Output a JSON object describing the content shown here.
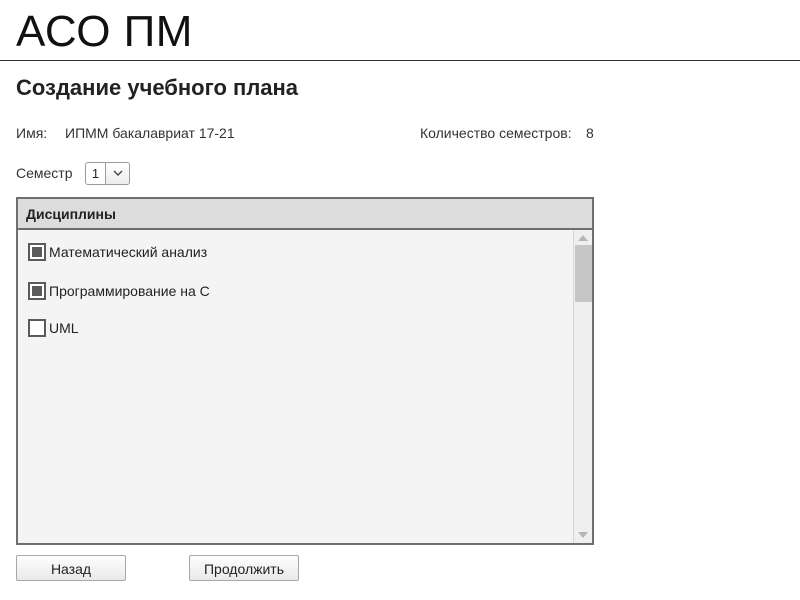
{
  "app": {
    "title": "АСО ПМ"
  },
  "page": {
    "title": "Создание учебного плана"
  },
  "info": {
    "name_label": "Имя:",
    "name_value": "ИПММ бакалавриат 17-21",
    "semester_count_label": "Количество семестров:",
    "semester_count_value": "8"
  },
  "semester": {
    "label": "Семестр",
    "selected": "1",
    "icon": "chevron-down-icon"
  },
  "disciplines": {
    "header": "Дисциплины",
    "items": [
      {
        "label": "Математический анализ",
        "checked": true
      },
      {
        "label": "Программирование на С",
        "checked": true
      },
      {
        "label": "UML",
        "checked": false
      }
    ]
  },
  "buttons": {
    "back": "Назад",
    "continue": "Продолжить"
  },
  "colors": {
    "border": "#6e6e6e",
    "header_bg": "#dcdcdc",
    "list_bg": "#f4f4f4",
    "checkbox_fill": "#5a5a5a"
  }
}
